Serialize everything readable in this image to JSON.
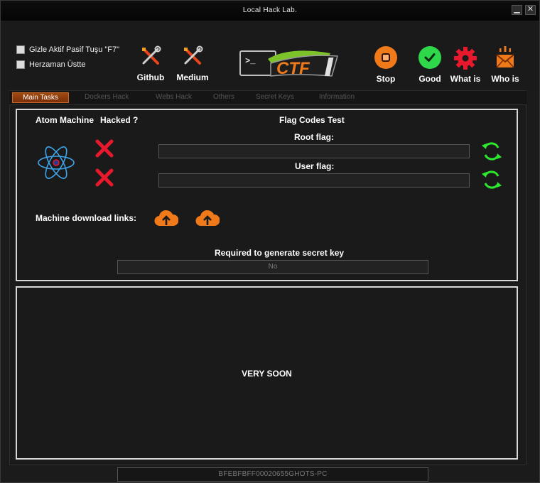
{
  "window": {
    "title": "Local Hack Lab.",
    "minimize_label": "▁",
    "close_label": "✕"
  },
  "options": [
    {
      "label": "Gizle Aktif Pasif Tuşu \"F7\"",
      "checked": false
    },
    {
      "label": "Herzaman Üstte",
      "checked": false
    }
  ],
  "links": {
    "github_label": "Github",
    "medium_label": "Medium"
  },
  "logo_text": "CTF",
  "actions": {
    "stop_label": "Stop",
    "good_label": "Good",
    "what_label": "What is",
    "who_label": "Who is"
  },
  "tabs": [
    "Main Tasks",
    "Dockers Hack",
    "Webs Hack",
    "Others",
    "Secret Keys",
    "Information"
  ],
  "main": {
    "machine_label": "Atom Machine",
    "hacked_label": "Hacked ?",
    "flag_test_label": "Flag Codes Test",
    "root_flag_label": "Root flag:",
    "root_flag_value": "",
    "user_flag_label": "User flag:",
    "user_flag_value": "",
    "download_label": "Machine download links:",
    "secret_label": "Required to generate secret key",
    "secret_value": "No",
    "soon_text": "VERY SOON"
  },
  "status_bar": "BFEBFBFF00020655GHOTS-PC",
  "colors": {
    "accent_orange": "#f07a1a",
    "good_green": "#2fd84a",
    "danger_red": "#e8192c",
    "refresh_green": "#2ee82e",
    "atom_blue": "#3fa3e8"
  }
}
